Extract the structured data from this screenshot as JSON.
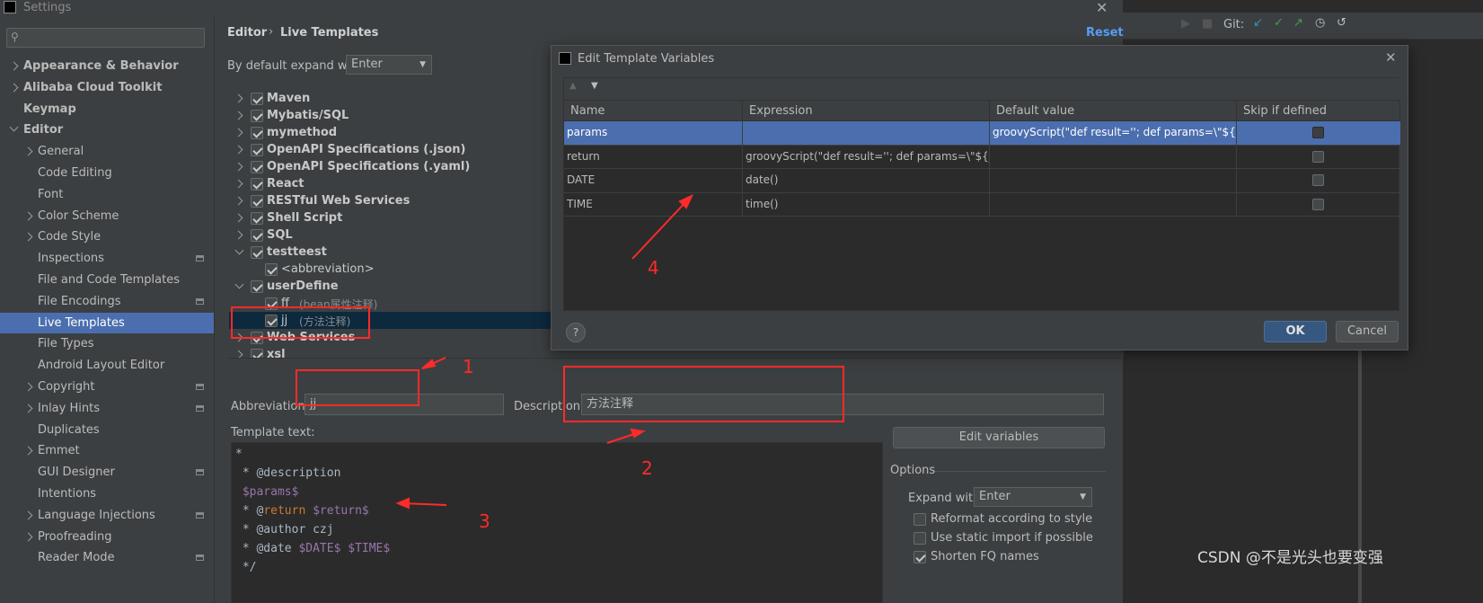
{
  "window": {
    "title": "Settings"
  },
  "sidebar": {
    "search_placeholder": "",
    "items": [
      {
        "label": "Appearance & Behavior",
        "indent": 0,
        "bold": true,
        "arrow": "right"
      },
      {
        "label": "Alibaba Cloud Toolkit",
        "indent": 0,
        "bold": true,
        "arrow": "right"
      },
      {
        "label": "Keymap",
        "indent": 0,
        "bold": true,
        "arrow": ""
      },
      {
        "label": "Editor",
        "indent": 0,
        "bold": true,
        "arrow": "down"
      },
      {
        "label": "General",
        "indent": 1,
        "arrow": "right"
      },
      {
        "label": "Code Editing",
        "indent": 1,
        "arrow": ""
      },
      {
        "label": "Font",
        "indent": 1,
        "arrow": ""
      },
      {
        "label": "Color Scheme",
        "indent": 1,
        "arrow": "right"
      },
      {
        "label": "Code Style",
        "indent": 1,
        "arrow": "right"
      },
      {
        "label": "Inspections",
        "indent": 1,
        "arrow": "",
        "badge": true
      },
      {
        "label": "File and Code Templates",
        "indent": 1,
        "arrow": ""
      },
      {
        "label": "File Encodings",
        "indent": 1,
        "arrow": "",
        "badge": true
      },
      {
        "label": "Live Templates",
        "indent": 1,
        "arrow": "",
        "selected": true
      },
      {
        "label": "File Types",
        "indent": 1,
        "arrow": ""
      },
      {
        "label": "Android Layout Editor",
        "indent": 1,
        "arrow": ""
      },
      {
        "label": "Copyright",
        "indent": 1,
        "arrow": "right",
        "badge": true
      },
      {
        "label": "Inlay Hints",
        "indent": 1,
        "arrow": "right",
        "badge": true
      },
      {
        "label": "Duplicates",
        "indent": 1,
        "arrow": ""
      },
      {
        "label": "Emmet",
        "indent": 1,
        "arrow": "right"
      },
      {
        "label": "GUI Designer",
        "indent": 1,
        "arrow": "",
        "badge": true
      },
      {
        "label": "Intentions",
        "indent": 1,
        "arrow": ""
      },
      {
        "label": "Language Injections",
        "indent": 1,
        "arrow": "right",
        "badge": true
      },
      {
        "label": "Proofreading",
        "indent": 1,
        "arrow": "right"
      },
      {
        "label": "Reader Mode",
        "indent": 1,
        "arrow": "",
        "badge": true
      }
    ]
  },
  "header": {
    "breadcrumb_root": "Editor",
    "breadcrumb_sep": "›",
    "breadcrumb_leaf": "Live Templates",
    "reset": "Reset"
  },
  "expand": {
    "label": "By default expand with",
    "value": "Enter"
  },
  "tree": [
    {
      "label": "Maven",
      "level": 0,
      "arrow": "right",
      "checked": true
    },
    {
      "label": "Mybatis/SQL",
      "level": 0,
      "arrow": "right",
      "checked": true
    },
    {
      "label": "mymethod",
      "level": 0,
      "arrow": "right",
      "checked": true
    },
    {
      "label": "OpenAPI Specifications (.json)",
      "level": 0,
      "arrow": "right",
      "checked": true
    },
    {
      "label": "OpenAPI Specifications (.yaml)",
      "level": 0,
      "arrow": "right",
      "checked": true
    },
    {
      "label": "React",
      "level": 0,
      "arrow": "right",
      "checked": true
    },
    {
      "label": "RESTful Web Services",
      "level": 0,
      "arrow": "right",
      "checked": true
    },
    {
      "label": "Shell Script",
      "level": 0,
      "arrow": "right",
      "checked": true
    },
    {
      "label": "SQL",
      "level": 0,
      "arrow": "right",
      "checked": true
    },
    {
      "label": "testteest",
      "level": 0,
      "arrow": "down",
      "checked": true
    },
    {
      "label": "<abbreviation>",
      "level": 1,
      "arrow": "",
      "checked": true
    },
    {
      "label": "userDefine",
      "level": 0,
      "arrow": "down",
      "checked": true
    },
    {
      "label": "ff",
      "desc": "(bean属性注释)",
      "level": 1,
      "arrow": "",
      "checked": true
    },
    {
      "label": "jj",
      "desc": "(方法注释)",
      "level": 1,
      "arrow": "",
      "checked": true,
      "selected": true
    },
    {
      "label": "Web Services",
      "level": 0,
      "arrow": "right",
      "checked": true
    },
    {
      "label": "xsl",
      "level": 0,
      "arrow": "right",
      "checked": true
    }
  ],
  "form": {
    "abbreviation_label": "Abbreviation:",
    "abbreviation_value": "jj",
    "description_label": "Description:",
    "description_value": "方法注释",
    "template_text_label": "Template text:",
    "edit_variables": "Edit variables",
    "options_label": "Options",
    "expand_with_label": "Expand with",
    "expand_with_value": "Enter",
    "options": [
      {
        "label": "Reformat according to style",
        "checked": false
      },
      {
        "label": "Use static import if possible",
        "checked": false
      },
      {
        "label": "Shorten FQ names",
        "checked": true
      }
    ]
  },
  "template_lines": [
    [
      {
        "t": "*",
        "c": "plain"
      }
    ],
    [
      {
        "t": " * @description",
        "c": "plain"
      }
    ],
    [
      {
        "t": " $params$",
        "c": "var"
      }
    ],
    [
      {
        "t": " * @",
        "c": "plain"
      },
      {
        "t": "return",
        "c": "kw"
      },
      {
        "t": " ",
        "c": "plain"
      },
      {
        "t": "$return$",
        "c": "var"
      }
    ],
    [
      {
        "t": " * @author czj",
        "c": "plain"
      }
    ],
    [
      {
        "t": " * @date ",
        "c": "plain"
      },
      {
        "t": "$DATE$",
        "c": "var"
      },
      {
        "t": " ",
        "c": "plain"
      },
      {
        "t": "$TIME$",
        "c": "var"
      }
    ],
    [
      {
        "t": " */",
        "c": "plain"
      }
    ]
  ],
  "dialog": {
    "title": "Edit Template Variables",
    "columns": [
      "Name",
      "Expression",
      "Default value",
      "Skip if defined"
    ],
    "rows": [
      {
        "name": "params",
        "expression": "",
        "default": "groovyScript(\"def result=''; def params=\\\"${_1}...",
        "skip": false,
        "selected": true
      },
      {
        "name": "return",
        "expression": "groovyScript(\"def result=''; def params=\\\"${_1}...",
        "default": "",
        "skip": false
      },
      {
        "name": "DATE",
        "expression": "date()",
        "default": "",
        "skip": false
      },
      {
        "name": "TIME",
        "expression": "time()",
        "default": "",
        "skip": false
      }
    ],
    "ok": "OK",
    "cancel": "Cancel",
    "help": "?"
  },
  "background_toolbar": {
    "git_label": "Git:"
  },
  "annotations": [
    "1",
    "2",
    "3",
    "4"
  ],
  "watermark": "CSDN @不是光头也要变强",
  "colors": {
    "selection": "#4b6eaf",
    "tree_selection": "#0d293e",
    "annotation": "#ff2a2a",
    "var": "#9876aa",
    "kw": "#cc7832"
  }
}
